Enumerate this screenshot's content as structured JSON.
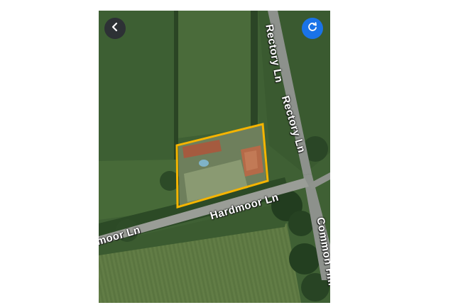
{
  "map": {
    "type": "satellite",
    "roads": {
      "rectory_ln": "Rectory Ln",
      "hardmoor_ln_main": "Hardmoor Ln",
      "hardmoor_ln_partial": "moor Ln",
      "common_hill": "Common Hill"
    },
    "boundary_color": "#f5b400"
  },
  "controls": {
    "back": {
      "icon": "chevron-left-icon",
      "color": "#2d3135"
    },
    "refresh": {
      "icon": "refresh-icon",
      "color": "#1a73e8"
    }
  }
}
